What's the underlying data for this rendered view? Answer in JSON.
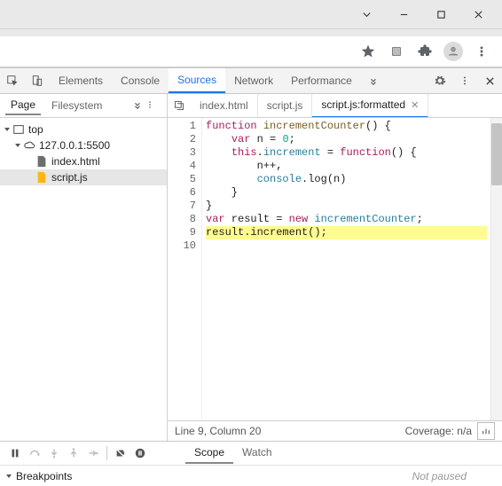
{
  "devtools_tabs": [
    "Elements",
    "Console",
    "Sources",
    "Network",
    "Performance"
  ],
  "devtools_active": "Sources",
  "nav": {
    "tabs": [
      "Page",
      "Filesystem"
    ],
    "active": "Page",
    "tree": {
      "top_label": "top",
      "host": "127.0.0.1:5500",
      "files": [
        {
          "name": "index.html",
          "kind": "file"
        },
        {
          "name": "script.js",
          "kind": "script",
          "selected": true
        }
      ]
    }
  },
  "editor": {
    "tabs": [
      {
        "label": "index.html"
      },
      {
        "label": "script.js"
      },
      {
        "label": "script.js:formatted",
        "active": true,
        "closable": true
      }
    ],
    "code": [
      {
        "n": 1,
        "html": "<span class='kw'>function</span> <span class='fn'>incrementCounter</span>() {"
      },
      {
        "n": 2,
        "html": "    <span class='kw'>var</span> n = <span class='num'>0</span>;"
      },
      {
        "n": 3,
        "html": "    <span class='kw'>this</span>.<span class='prop'>increment</span> = <span class='kw'>function</span>() {"
      },
      {
        "n": 4,
        "html": "        n++,"
      },
      {
        "n": 5,
        "html": "        <span class='console'>console</span>.log(n)"
      },
      {
        "n": 6,
        "html": "    }"
      },
      {
        "n": 7,
        "html": "}"
      },
      {
        "n": 8,
        "html": "<span class='kw'>var</span> result = <span class='kw'>new</span> <span class='ident'>incrementCounter</span>;"
      },
      {
        "n": 9,
        "html": "result.increment();",
        "hl": true
      },
      {
        "n": 10,
        "html": ""
      }
    ],
    "status_left": "Line 9, Column 20",
    "status_right": "Coverage: n/a"
  },
  "debugger": {
    "scope_label": "Scope",
    "watch_label": "Watch",
    "breakpoints_label": "Breakpoints",
    "state": "Not paused"
  }
}
